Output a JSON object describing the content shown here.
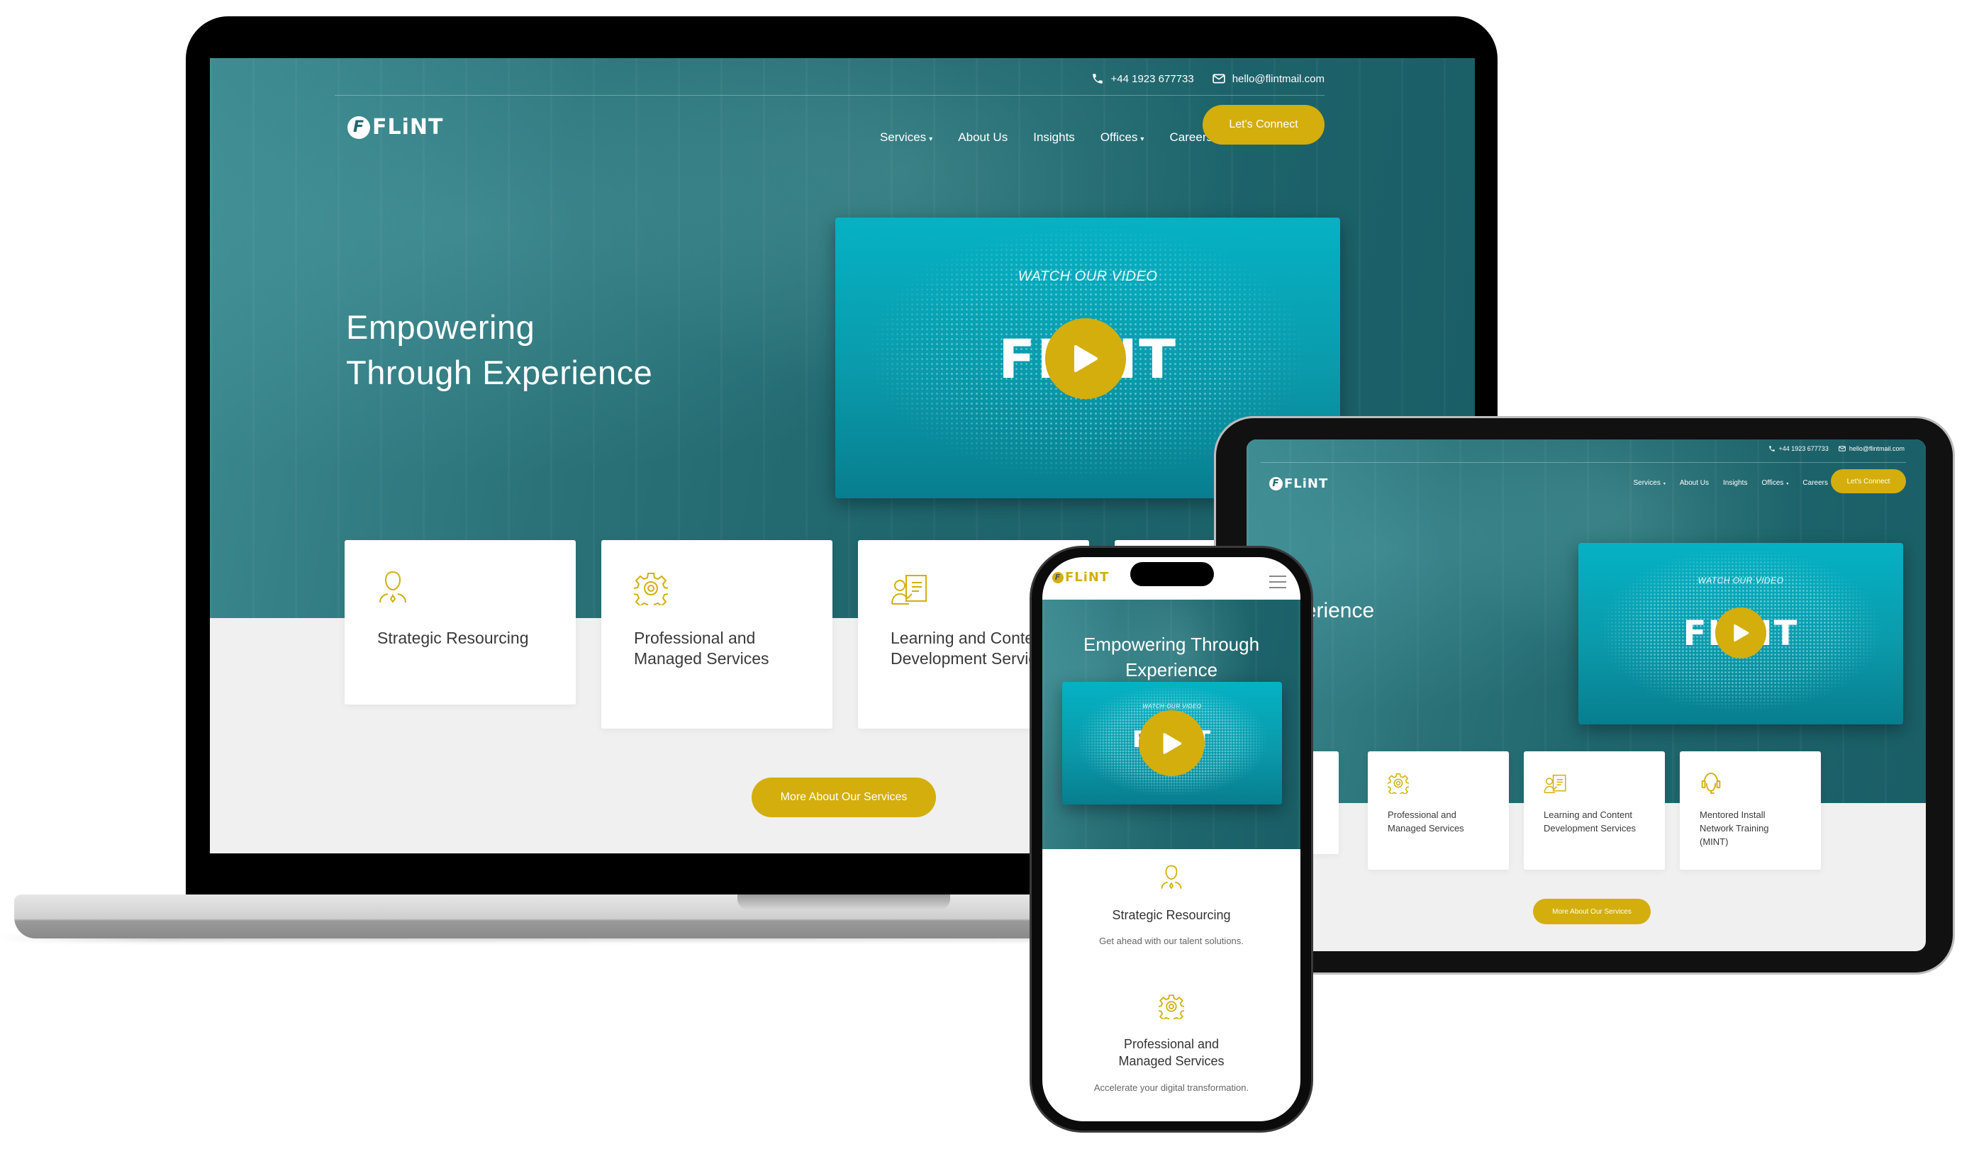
{
  "brand": {
    "name": "FLINT",
    "logo_text": "FLiNT",
    "logo_mark": "F",
    "accent": "#d3ae0d",
    "teal": "#1f666d",
    "video_teal": "#0a9aab"
  },
  "topbar": {
    "phone_icon": "phone-icon",
    "phone": "+44 1923 677733",
    "email_icon": "envelope-icon",
    "email": "hello@flintmail.com"
  },
  "nav": {
    "items": [
      {
        "label": "Services",
        "dropdown": true
      },
      {
        "label": "About Us",
        "dropdown": false
      },
      {
        "label": "Insights",
        "dropdown": false
      },
      {
        "label": "Offices",
        "dropdown": true
      },
      {
        "label": "Careers",
        "dropdown": false
      }
    ],
    "caret": "▾",
    "cta": "Let's Connect"
  },
  "hero": {
    "line1": "Empowering",
    "line2": "Through Experience",
    "mobile_title": "Empowering Through Experience"
  },
  "video": {
    "label": "WATCH OUR VIDEO",
    "brand": "FLiNT",
    "play_icon": "play-icon"
  },
  "services": [
    {
      "icon": "person-icon",
      "title_l1": "Strategic Resourcing",
      "title_l2": "",
      "title_l3": "",
      "desc": "Get ahead with our talent solutions."
    },
    {
      "icon": "gear-icon",
      "title_l1": "Professional and",
      "title_l2": "Managed Services",
      "title_l3": "",
      "desc": "Accelerate your digital transformation."
    },
    {
      "icon": "presenter-icon",
      "title_l1": "Learning and Content",
      "title_l2": "Development Services",
      "title_l3": ""
    },
    {
      "icon": "headset-icon",
      "title_l1": "Mentored Install",
      "title_l2": "Network Training",
      "title_l3": "(MINT)"
    }
  ],
  "services_cta": "More About Our Services",
  "mobile": {
    "menu_icon": "hamburger-menu-icon"
  }
}
